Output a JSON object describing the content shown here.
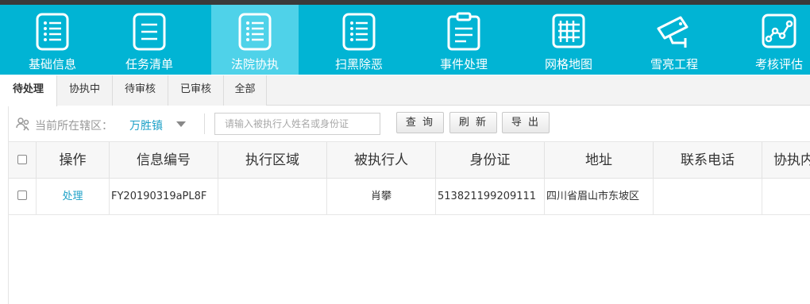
{
  "nav": {
    "items": [
      {
        "label": "基础信息",
        "icon": "list-document-icon"
      },
      {
        "label": "任务清单",
        "icon": "task-list-icon"
      },
      {
        "label": "法院协执",
        "icon": "court-list-icon"
      },
      {
        "label": "扫黑除恶",
        "icon": "document-list-icon"
      },
      {
        "label": "事件处理",
        "icon": "clipboard-icon"
      },
      {
        "label": "网格地图",
        "icon": "grid-map-icon"
      },
      {
        "label": "雪亮工程",
        "icon": "surveillance-camera-icon"
      },
      {
        "label": "考核评估",
        "icon": "line-chart-icon"
      }
    ],
    "active_index": 2
  },
  "tabs": [
    "待处理",
    "协执中",
    "待审核",
    "已审核",
    "全部"
  ],
  "filter": {
    "location_label": "当前所在辖区：",
    "location_value": "万胜镇",
    "search_placeholder": "请输入被执行人姓名或身份证",
    "query_label": "查 询",
    "refresh_label": "刷 新",
    "export_label": "导 出"
  },
  "table": {
    "headers": [
      "操作",
      "信息编号",
      "执行区域",
      "被执行人",
      "身份证",
      "地址",
      "联系电话",
      "协执内"
    ],
    "rows": [
      {
        "action": "处理",
        "info_id": "FY20190319aPL8F",
        "region": "",
        "person": "肖攀",
        "id_card": "513821199209111",
        "address": "四川省眉山市东坡区",
        "phone": "",
        "content": ""
      }
    ]
  },
  "colors": {
    "nav_bg": "#01b4d4",
    "nav_active": "#4fd2e9",
    "link": "#1da1c7"
  }
}
